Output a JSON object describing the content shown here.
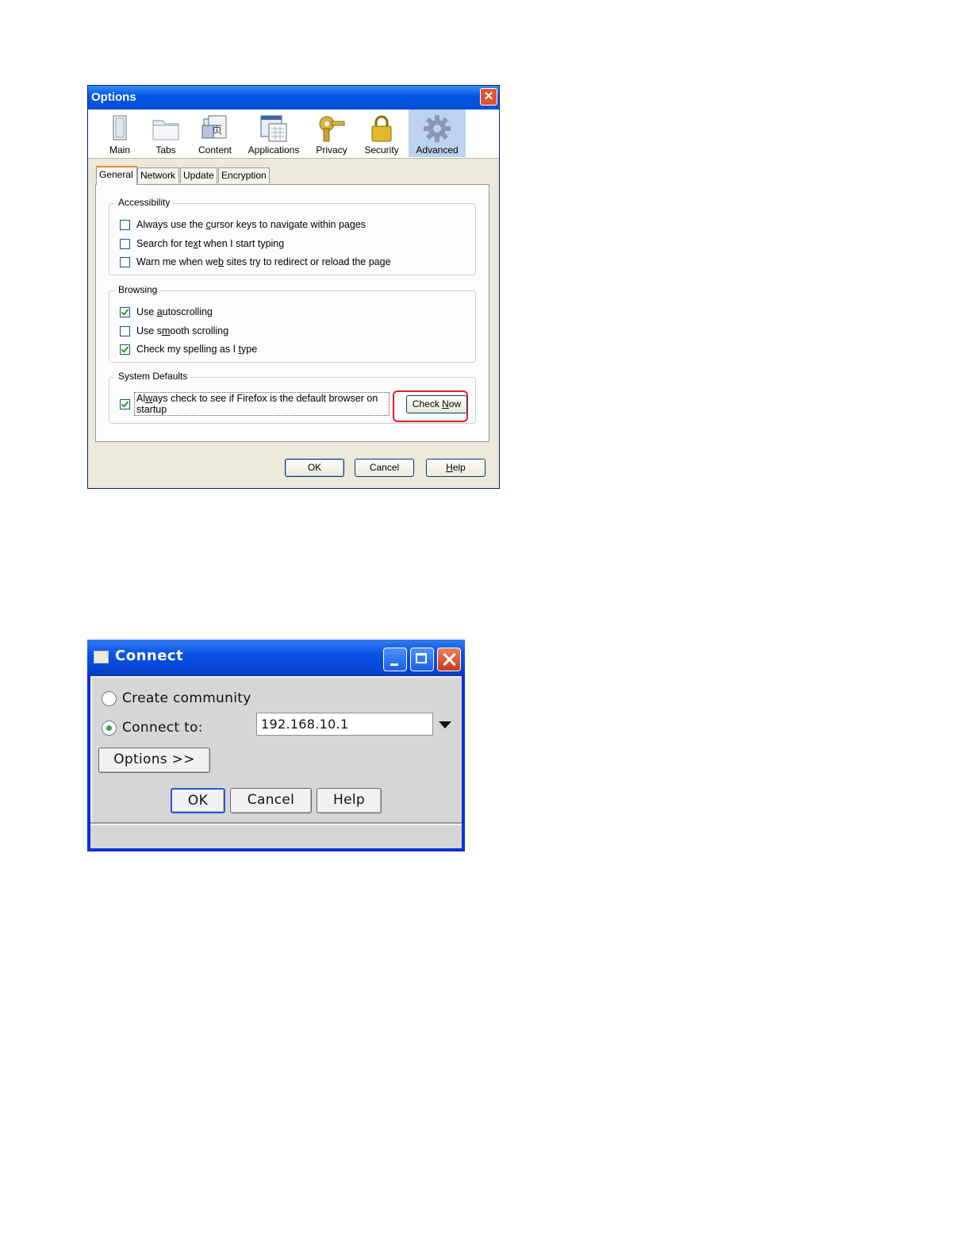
{
  "options_dialog": {
    "title": "Options",
    "panes": [
      {
        "label": "Main",
        "icon": "main-window-icon"
      },
      {
        "label": "Tabs",
        "icon": "tabs-folder-icon"
      },
      {
        "label": "Content",
        "icon": "content-icon"
      },
      {
        "label": "Applications",
        "icon": "applications-icon"
      },
      {
        "label": "Privacy",
        "icon": "privacy-key-icon"
      },
      {
        "label": "Security",
        "icon": "security-lock-icon"
      },
      {
        "label": "Advanced",
        "icon": "advanced-gear-icon",
        "selected": true
      }
    ],
    "tabs": [
      "General",
      "Network",
      "Update",
      "Encryption"
    ],
    "selected_tab": "General",
    "accessibility": {
      "legend": "Accessibility",
      "items": [
        {
          "pre": "Always use the ",
          "key": "c",
          "post": "ursor keys to navigate within pages",
          "checked": false
        },
        {
          "pre": "Search for te",
          "key": "x",
          "post": "t when I start typing",
          "checked": false
        },
        {
          "pre": "Warn me when we",
          "key": "b",
          "post": " sites try to redirect or reload the page",
          "checked": false
        }
      ]
    },
    "browsing": {
      "legend": "Browsing",
      "items": [
        {
          "pre": "Use ",
          "key": "a",
          "post": "utoscrolling",
          "checked": true
        },
        {
          "pre": "Use s",
          "key": "m",
          "post": "ooth scrolling",
          "checked": false
        },
        {
          "pre": "Check my spelling as I ",
          "key": "t",
          "post": "ype",
          "checked": true
        }
      ]
    },
    "system_defaults": {
      "legend": "System Defaults",
      "default_check": {
        "pre": "Al",
        "key": "w",
        "post": "ays check to see if Firefox is the default browser on",
        "line2": "startup",
        "checked": true
      },
      "check_now": {
        "pre": "Check ",
        "key": "N",
        "post": "ow"
      }
    },
    "buttons": {
      "ok": "OK",
      "cancel": "Cancel",
      "help_key": "H",
      "help_rest": "elp"
    },
    "colors": {
      "highlight": "#e0202a",
      "selected_pane": "#bcd2ee",
      "active_tab_top": "#e68b2c"
    }
  },
  "connect_dialog": {
    "title": "Connect",
    "create_community_label": "Create community",
    "connect_to_label": "Connect to:",
    "address_value": "192.168.10.1",
    "create_selected": false,
    "connect_selected": true,
    "options_button": "Options >>",
    "buttons": {
      "ok": "OK",
      "cancel": "Cancel",
      "help": "Help"
    }
  }
}
